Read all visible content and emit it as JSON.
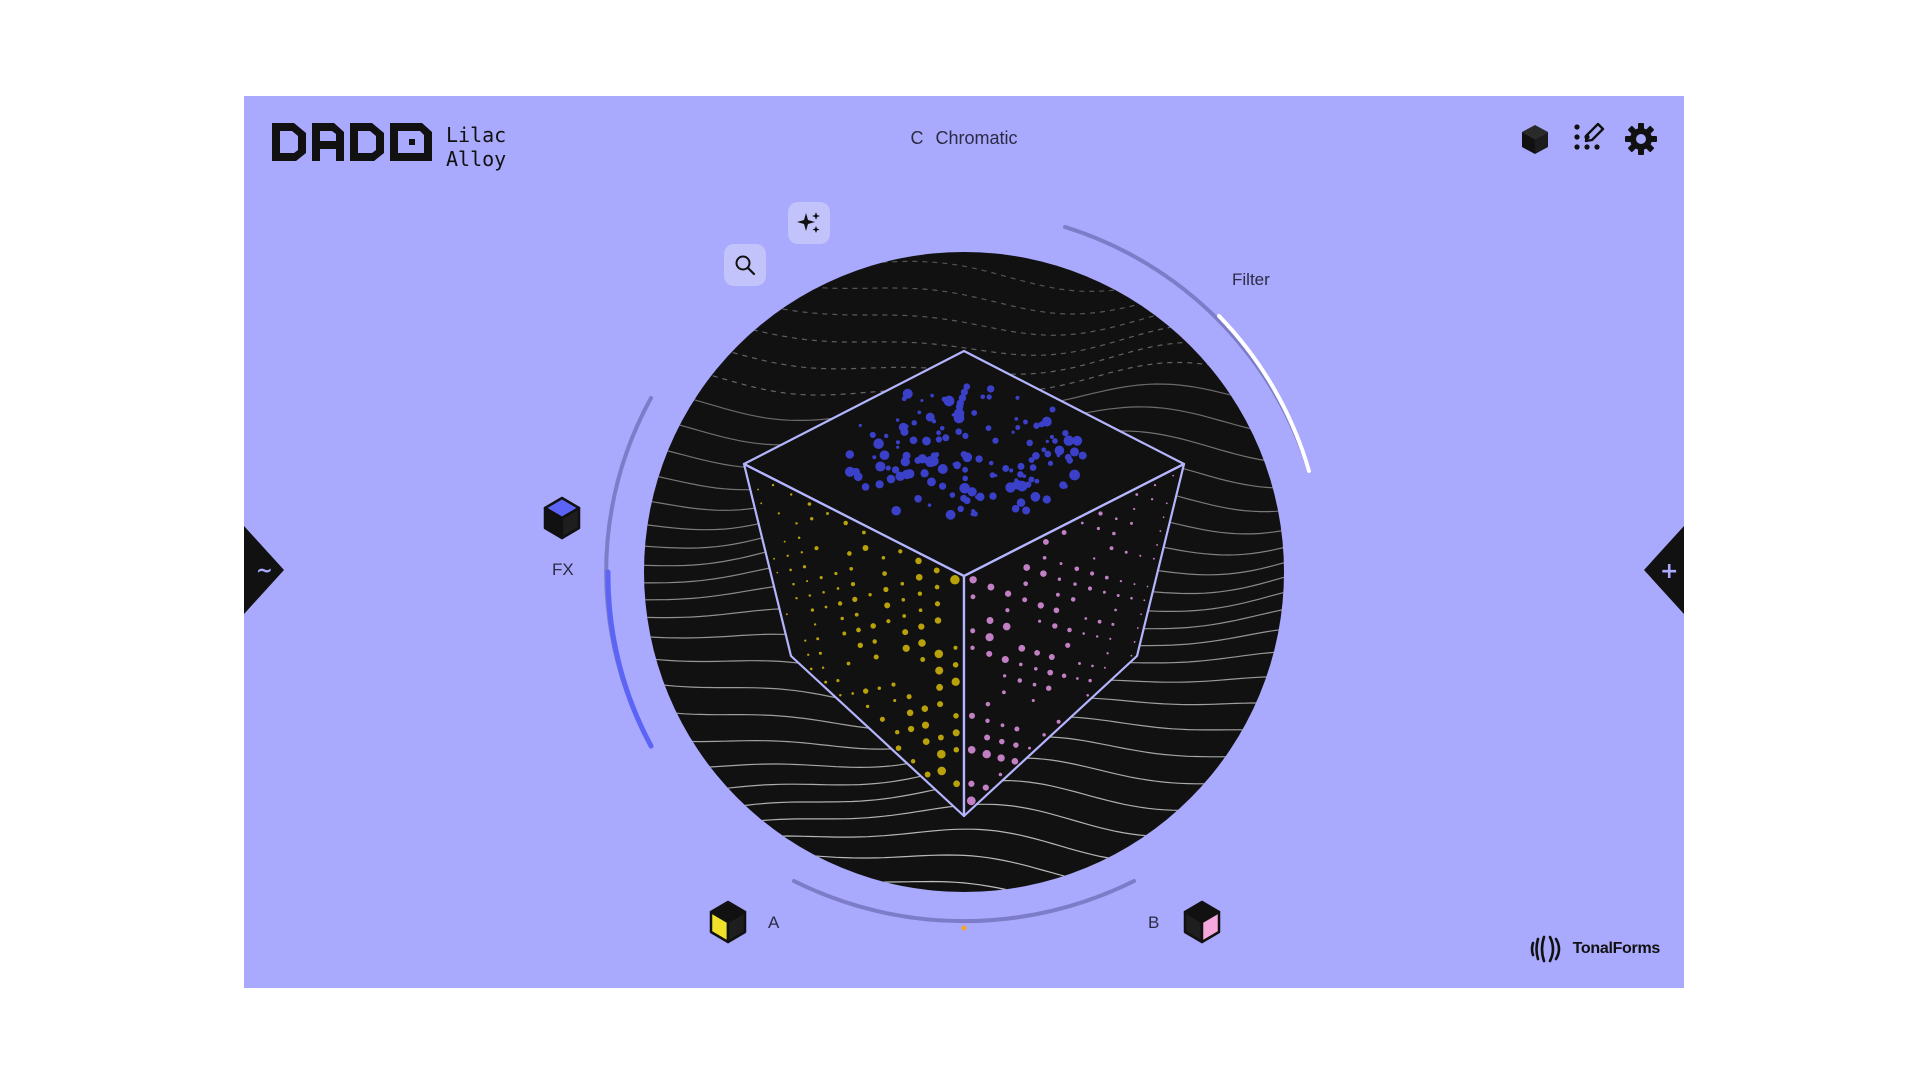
{
  "app": {
    "logo_text": "DADO",
    "preset": {
      "line1": "Lilac",
      "line2": "Alloy"
    },
    "scale": {
      "key": "C",
      "name": "Chromatic"
    }
  },
  "toolbar": {
    "icons": [
      "cube-icon",
      "edit-pattern-icon",
      "gear-icon"
    ]
  },
  "controls": {
    "filter_label": "Filter",
    "filter_value": 0.55,
    "fx_label": "FX",
    "fx_value": 0.5,
    "a_label": "A",
    "b_label": "B",
    "ab_mix": 0.5,
    "left_tab_symbol": "~",
    "right_tab_symbol": "+"
  },
  "brand": {
    "name": "TonalForms"
  },
  "colors": {
    "background": "#a9a9fd",
    "dark": "#111111",
    "accent_blue": "#5b64f5",
    "dots_top": "#3b40c9",
    "dots_left": "#b8a10a",
    "dots_right": "#c37fc4",
    "cube_a": "#f0e02a",
    "cube_b": "#f5a8dc"
  }
}
